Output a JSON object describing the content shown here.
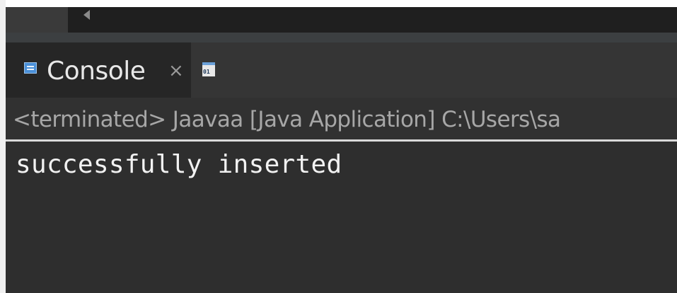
{
  "console": {
    "tabs": [
      {
        "label": "Console",
        "close_glyph": "×",
        "icon": "console-icon",
        "active": true
      },
      {
        "label": "",
        "icon": "binary-view-icon",
        "icon_text": "01"
      }
    ],
    "status": "<terminated> Jaavaa [Java Application] C:\\Users\\sa",
    "output_lines": [
      "successfully inserted"
    ]
  },
  "colors": {
    "background": "#2e2e2e",
    "text": "#f2f2f2",
    "status_text": "#a7a7a7",
    "accent": "#4a90d9"
  }
}
